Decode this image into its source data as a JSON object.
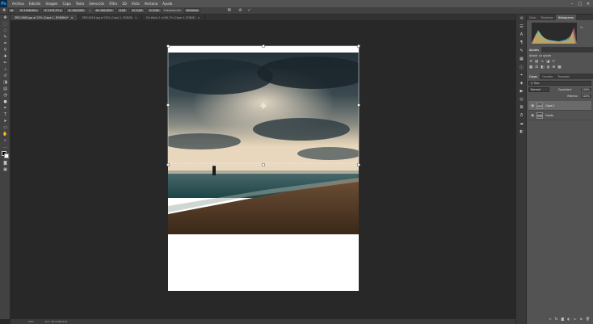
{
  "menu": {
    "items": [
      "Archivo",
      "Edición",
      "Imagen",
      "Capa",
      "Texto",
      "Selección",
      "Filtro",
      "3D",
      "Vista",
      "Ventana",
      "Ayuda"
    ]
  },
  "options_bar": {
    "fields": [
      "X: 1416,00 p",
      "Y: 1175,75 p",
      "A: 100,00%",
      "Al: 100,00%",
      "0,00",
      "H: 0,00",
      "V: 0,00"
    ],
    "interpolation_label": "Interpolación:",
    "interpolation_value": "Bicúbica"
  },
  "tabs": [
    {
      "label": "ZRIC4008.jpg al 25% (Capa 1, RGB/8#)*"
    },
    {
      "label": "ZRIC4016.jpg al 25% (Capa 1, RGB/8)"
    },
    {
      "label": "Sin título-1 al 66,7% (Capa 4, RGB/8)"
    }
  ],
  "status": {
    "zoom": "25%",
    "doc": "Doc: 36,9 M/5,9 M"
  },
  "panels": {
    "top_tabs": [
      "Color",
      "Muestras",
      "Histograma"
    ],
    "adjust_tabs": [
      "Ajustes"
    ],
    "adjust_label": "Añadir un ajuste",
    "layers_tabs": [
      "Capas",
      "Canales",
      "Trazados"
    ],
    "blend_mode": "Normal",
    "opacity_label": "Opacidad:",
    "opacity_value": "100%",
    "fill_label": "Relleno:",
    "fill_value": "100%",
    "layers": [
      {
        "name": "Capa 1",
        "selected": true
      },
      {
        "name": "Fondo",
        "selected": false
      }
    ]
  }
}
